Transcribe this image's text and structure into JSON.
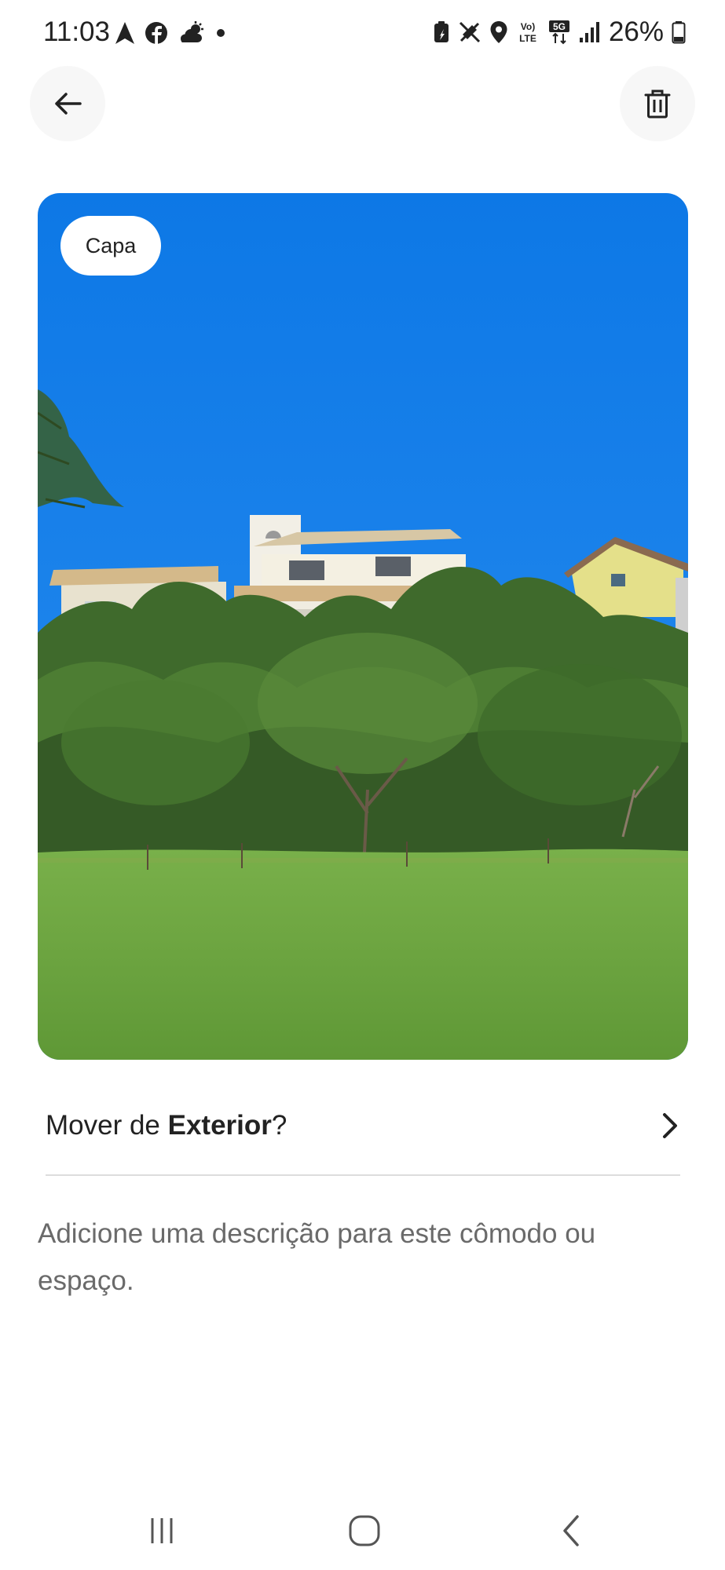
{
  "status_bar": {
    "time": "11:03",
    "battery": "26%",
    "left_icons": [
      "navigation-icon",
      "facebook-icon",
      "weather-icon",
      "dot-icon"
    ],
    "right_icons": [
      "battery-saver-icon",
      "mute-icon",
      "location-icon",
      "volte-icon",
      "5g-icon",
      "signal-icon",
      "battery-icon"
    ]
  },
  "toolbar": {
    "back_icon": "arrow-left-icon",
    "delete_icon": "trash-icon"
  },
  "photo": {
    "badge": "Capa"
  },
  "move_row": {
    "prefix": "Mover de ",
    "room": "Exterior",
    "suffix": "?",
    "chevron_icon": "chevron-right-icon"
  },
  "description": {
    "placeholder": "Adicione uma descrição para este cômodo ou espaço."
  },
  "nav_bar": {
    "icons": [
      "recents-icon",
      "home-icon",
      "back-icon"
    ]
  },
  "colors": {
    "sky": "#1a82e8",
    "grass": "#6ea83e",
    "text": "#222222",
    "muted_text": "#6a6a6a"
  }
}
